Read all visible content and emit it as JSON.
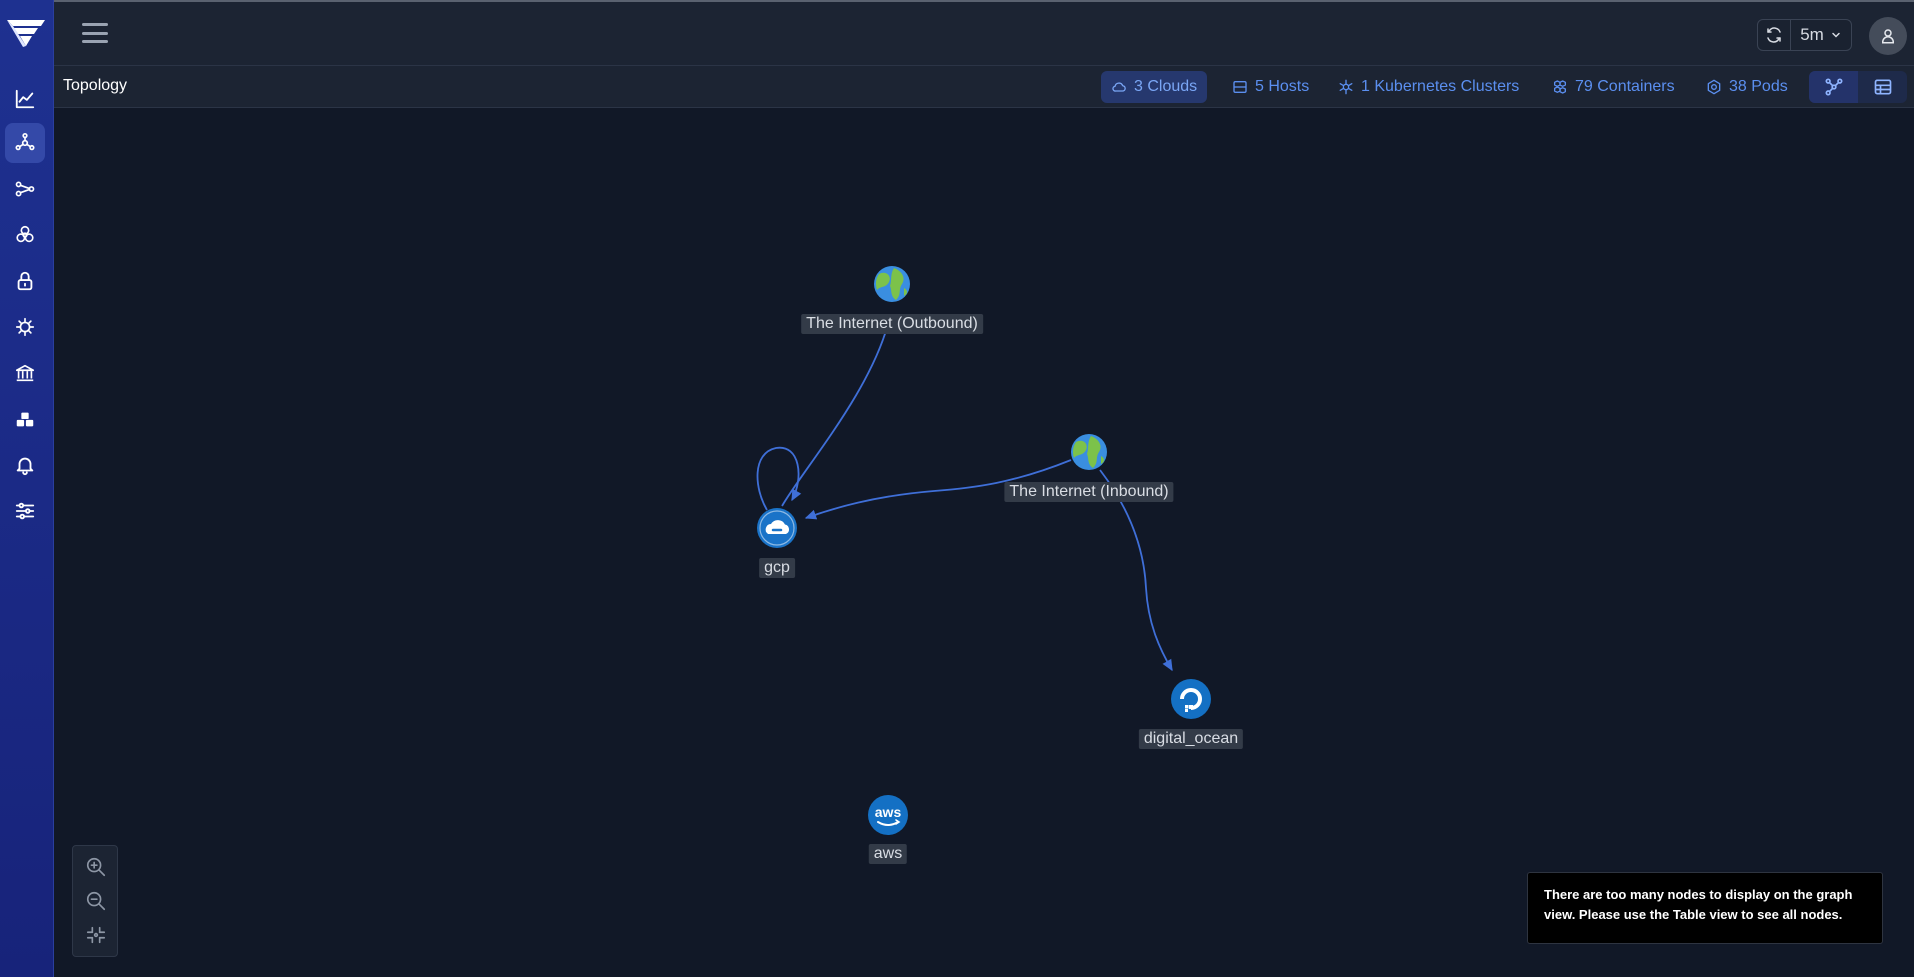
{
  "topbar": {
    "interval": "5m"
  },
  "page": {
    "title": "Topology"
  },
  "stats": [
    {
      "label": "3 Clouds",
      "icon": "cloud-icon"
    },
    {
      "label": "5 Hosts",
      "icon": "server-icon"
    },
    {
      "label": "1 Kubernetes Clusters",
      "icon": "kubernetes-icon"
    },
    {
      "label": "79 Containers",
      "icon": "containers-icon"
    },
    {
      "label": "38 Pods",
      "icon": "pod-icon"
    }
  ],
  "graph": {
    "nodes": [
      {
        "id": "internet-out",
        "label": "The Internet (Outbound)",
        "icon": "globe-icon"
      },
      {
        "id": "internet-in",
        "label": "The Internet (Inbound)",
        "icon": "globe-icon"
      },
      {
        "id": "gcp",
        "label": "gcp",
        "icon": "gcp-cloud-icon"
      },
      {
        "id": "digital_ocean",
        "label": "digital_ocean",
        "icon": "digitalocean-icon"
      },
      {
        "id": "aws",
        "label": "aws",
        "icon": "aws-icon"
      }
    ],
    "edges": [
      {
        "from": "gcp",
        "to": "internet-out"
      },
      {
        "from": "gcp",
        "to": "gcp"
      },
      {
        "from": "internet-in",
        "to": "gcp"
      },
      {
        "from": "internet-in",
        "to": "digital_ocean"
      }
    ]
  },
  "notice": {
    "text": "There are too many nodes to display on the graph view. Please use the Table view to see all nodes."
  },
  "colors": {
    "accent": "#5b8ff0",
    "edge": "#3f6fd8",
    "sidebar": "#1e3190",
    "background": "#111827"
  }
}
